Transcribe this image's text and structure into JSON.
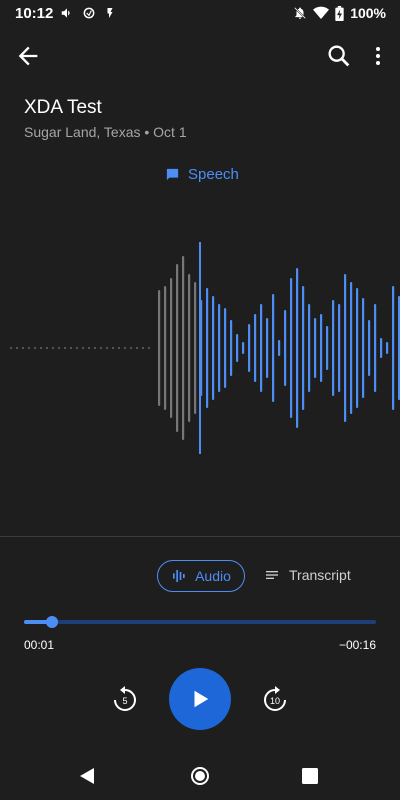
{
  "status_bar": {
    "time": "10:12",
    "battery": "100%"
  },
  "recording": {
    "title": "XDA Test",
    "subtitle": "Sugar Land, Texas • Oct 1",
    "speech_label": "Speech"
  },
  "tabs": {
    "audio_label": "Audio",
    "transcript_label": "Transcript"
  },
  "playback": {
    "current_time": "00:01",
    "remaining_time": "−00:16",
    "progress_fraction": 0.08,
    "rewind_label": "5",
    "forward_label": "10"
  },
  "colors": {
    "accent": "#4d8ef5",
    "background": "#1e1e1e",
    "play_button": "#1e67d8",
    "played_wave": "#777777"
  }
}
